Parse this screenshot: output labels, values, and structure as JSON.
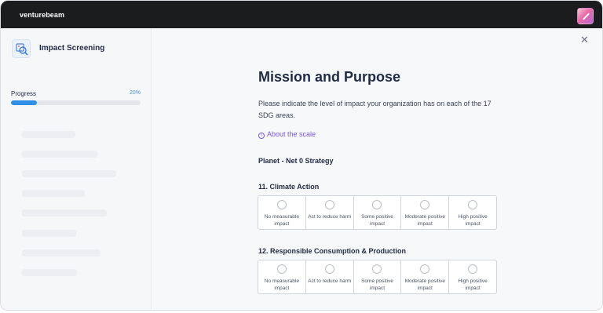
{
  "topbar": {
    "brand": "venturebeam",
    "avatar_icon": "user-avatar-icon"
  },
  "sidebar": {
    "title": "Impact Screening",
    "logo_icon": "impact-screening-logo-icon",
    "progress": {
      "label": "Progress",
      "percent_text": "20%",
      "value": 0.2
    }
  },
  "main": {
    "close_icon": "close-icon",
    "heading": "Mission and Purpose",
    "lead": "Please indicate the level of impact your organization has on each of the 17 SDG areas.",
    "about_link": "About the scale",
    "section": "Planet - Net 0 Strategy",
    "questions": [
      {
        "title": "11. Climate Action"
      },
      {
        "title": "12. Responsible Consumption & Production"
      }
    ],
    "scale_options": [
      "No measurable impact",
      "Act to reduce harm",
      "Some positive impact",
      "Moderate positive impact",
      "High positive impact"
    ]
  }
}
